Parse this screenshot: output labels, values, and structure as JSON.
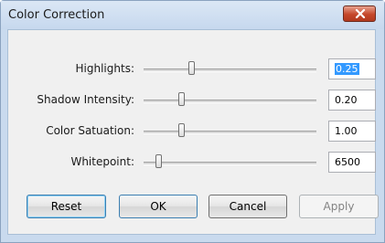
{
  "window": {
    "title": "Color Correction"
  },
  "controls": [
    {
      "label": "Highlights:",
      "value": "0.25",
      "slider_position": 0.27,
      "selected": true
    },
    {
      "label": "Shadow Intensity:",
      "value": "0.20",
      "slider_position": 0.21,
      "selected": false
    },
    {
      "label": "Color Satuation:",
      "value": "1.00",
      "slider_position": 0.21,
      "selected": false
    },
    {
      "label": "Whitepoint:",
      "value": "6500",
      "slider_position": 0.07,
      "selected": false
    }
  ],
  "buttons": {
    "reset": "Reset",
    "ok": "OK",
    "cancel": "Cancel",
    "apply": "Apply"
  },
  "colors": {
    "frame": "#c9daee",
    "close_button": "#c5472a",
    "selection": "#3399ff",
    "focus_border": "#3c7fb1"
  },
  "icons": {
    "close": "close-x-icon"
  }
}
